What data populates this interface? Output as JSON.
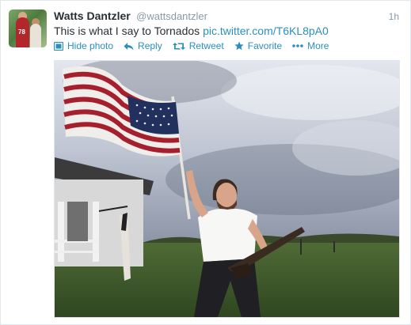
{
  "tweet": {
    "fullname": "Watts Dantzler",
    "username": "@wattsdantzler",
    "timestamp": "1h",
    "text_prefix": "This is what I say to Tornados ",
    "link_text": "pic.twitter.com/T6KL8pA0",
    "avatar_jersey_number": "78"
  },
  "actions": {
    "hide_photo": "Hide photo",
    "reply": "Reply",
    "retweet": "Retweet",
    "favorite": "Favorite",
    "more": "More"
  },
  "colors": {
    "link": "#2a8fbd",
    "name": "#292f33",
    "muted": "#8899a6"
  },
  "icons": [
    "photo-icon",
    "reply-icon",
    "retweet-icon",
    "star-icon",
    "more-dots-icon"
  ]
}
